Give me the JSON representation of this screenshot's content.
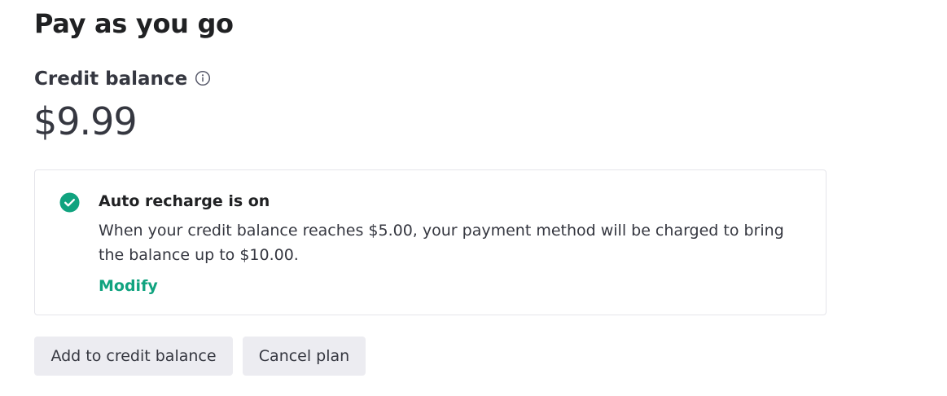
{
  "page": {
    "title": "Pay as you go"
  },
  "balance": {
    "label": "Credit balance",
    "info_icon": "info-icon",
    "amount": "$9.99"
  },
  "auto_recharge": {
    "status_icon": "check-circle-icon",
    "title": "Auto recharge is on",
    "description": "When your credit balance reaches $5.00, your payment method will be charged to bring the balance up to $10.00.",
    "modify_label": "Modify"
  },
  "actions": {
    "add_credit_label": "Add to credit balance",
    "cancel_plan_label": "Cancel plan"
  },
  "colors": {
    "accent": "#10a37f",
    "button_bg": "#ececf1",
    "text": "#202123",
    "border": "#e5e5ea"
  }
}
